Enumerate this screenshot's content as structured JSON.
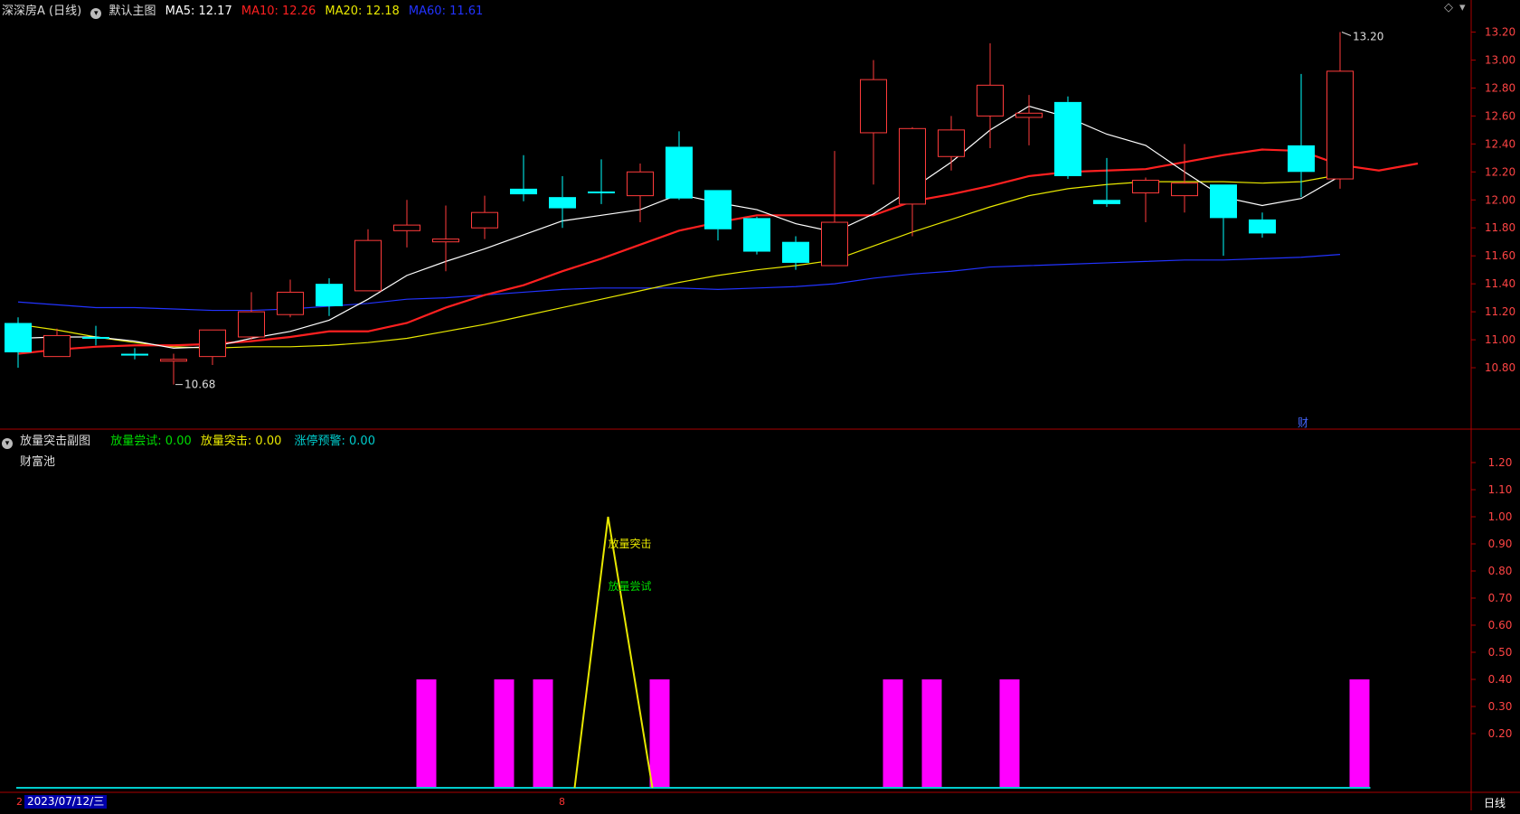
{
  "header": {
    "title": "深深房A (日线)",
    "main_chart_btn": "默认主图",
    "ma5_label": "MA5: 12.17",
    "ma10_label": "MA10: 12.26",
    "ma20_label": "MA20: 12.18",
    "ma60_label": "MA60: 11.61",
    "diamond_icon": "◇",
    "dropdown_icon": "▾"
  },
  "sub_header": {
    "title": "放量突击副图",
    "trial_label": "放量尝试: 0.00",
    "breakout_label": "放量突击: 0.00",
    "limitup_label": "涨停预警: 0.00",
    "pool_label": "财富池"
  },
  "colors": {
    "up": "#ff3b3b",
    "down": "#00ffff",
    "ma5": "#ffffff",
    "ma10": "#ff2020",
    "ma20": "#e8e800",
    "ma60": "#2233ff",
    "axis": "#aa0000",
    "magenta": "#ff00ff",
    "green": "#00dd00",
    "cyan": "#00cccc"
  },
  "bottom_bar": {
    "date": "2023/07/12/三",
    "left_marker": "2",
    "mid_marker": "8",
    "period": "日线"
  },
  "chart_data": [
    {
      "type": "candlestick",
      "ylim": [
        10.6,
        13.3
      ],
      "yticks": [
        "13.20",
        "13.00",
        "12.80",
        "12.60",
        "12.40",
        "12.20",
        "12.00",
        "11.80",
        "11.60",
        "11.40",
        "11.20",
        "11.00",
        "10.80"
      ],
      "high_annotation": "13.20",
      "low_annotation": "10.68",
      "marker_text": "财",
      "candles": [
        {
          "o": 11.12,
          "c": 10.91,
          "h": 11.16,
          "l": 10.8
        },
        {
          "o": 10.88,
          "c": 11.03,
          "h": 11.08,
          "l": 10.88
        },
        {
          "o": 11.02,
          "c": 11.01,
          "h": 11.1,
          "l": 10.96
        },
        {
          "o": 10.9,
          "c": 10.89,
          "h": 10.94,
          "l": 10.86
        },
        {
          "o": 10.85,
          "c": 10.86,
          "h": 10.9,
          "l": 10.68
        },
        {
          "o": 10.88,
          "c": 11.07,
          "h": 11.07,
          "l": 10.82
        },
        {
          "o": 11.02,
          "c": 11.2,
          "h": 11.34,
          "l": 11.0
        },
        {
          "o": 11.18,
          "c": 11.34,
          "h": 11.43,
          "l": 11.16
        },
        {
          "o": 11.4,
          "c": 11.24,
          "h": 11.44,
          "l": 11.17
        },
        {
          "o": 11.35,
          "c": 11.71,
          "h": 11.79,
          "l": 11.35
        },
        {
          "o": 11.78,
          "c": 11.82,
          "h": 12.0,
          "l": 11.66
        },
        {
          "o": 11.7,
          "c": 11.72,
          "h": 11.96,
          "l": 11.49
        },
        {
          "o": 11.8,
          "c": 11.91,
          "h": 12.03,
          "l": 11.72
        },
        {
          "o": 12.08,
          "c": 12.04,
          "h": 12.32,
          "l": 11.99
        },
        {
          "o": 12.02,
          "c": 11.94,
          "h": 12.17,
          "l": 11.8
        },
        {
          "o": 12.06,
          "c": 12.05,
          "h": 12.29,
          "l": 11.97
        },
        {
          "o": 12.03,
          "c": 12.2,
          "h": 12.26,
          "l": 11.84
        },
        {
          "o": 12.38,
          "c": 12.01,
          "h": 12.49,
          "l": 12.0
        },
        {
          "o": 12.07,
          "c": 11.79,
          "h": 12.07,
          "l": 11.71
        },
        {
          "o": 11.87,
          "c": 11.63,
          "h": 11.88,
          "l": 11.61
        },
        {
          "o": 11.7,
          "c": 11.55,
          "h": 11.74,
          "l": 11.5
        },
        {
          "o": 11.53,
          "c": 11.84,
          "h": 12.35,
          "l": 11.53
        },
        {
          "o": 12.48,
          "c": 12.86,
          "h": 13.0,
          "l": 12.11
        },
        {
          "o": 11.97,
          "c": 12.51,
          "h": 12.52,
          "l": 11.74
        },
        {
          "o": 12.31,
          "c": 12.5,
          "h": 12.6,
          "l": 12.21
        },
        {
          "o": 12.6,
          "c": 12.82,
          "h": 13.12,
          "l": 12.37
        },
        {
          "o": 12.59,
          "c": 12.62,
          "h": 12.75,
          "l": 12.39
        },
        {
          "o": 12.7,
          "c": 12.17,
          "h": 12.74,
          "l": 12.15
        },
        {
          "o": 12.0,
          "c": 11.97,
          "h": 12.3,
          "l": 11.95
        },
        {
          "o": 12.05,
          "c": 12.14,
          "h": 12.16,
          "l": 11.84
        },
        {
          "o": 12.03,
          "c": 12.12,
          "h": 12.4,
          "l": 11.91
        },
        {
          "o": 12.11,
          "c": 11.87,
          "h": 12.11,
          "l": 11.6
        },
        {
          "o": 11.86,
          "c": 11.76,
          "h": 11.91,
          "l": 11.73
        },
        {
          "o": 12.39,
          "c": 12.2,
          "h": 12.9,
          "l": 12.02
        },
        {
          "o": 12.15,
          "c": 12.92,
          "h": 13.2,
          "l": 12.08
        }
      ],
      "ma5": [
        11.01,
        11.02,
        11.02,
        10.99,
        10.94,
        10.95,
        11.01,
        11.06,
        11.14,
        11.29,
        11.46,
        11.56,
        11.65,
        11.75,
        11.85,
        11.89,
        11.93,
        12.04,
        11.98,
        11.93,
        11.83,
        11.77,
        11.9,
        12.08,
        12.27,
        12.5,
        12.67,
        12.59,
        12.47,
        12.39,
        12.2,
        12.02,
        11.96,
        12.01,
        12.17
      ],
      "ma10": [
        10.9,
        10.93,
        10.95,
        10.96,
        10.96,
        10.97,
        10.99,
        11.02,
        11.06,
        11.06,
        11.12,
        11.23,
        11.32,
        11.39,
        11.49,
        11.58,
        11.68,
        11.78,
        11.84,
        11.89,
        11.89,
        11.89,
        11.89,
        11.99,
        12.04,
        12.1,
        12.17,
        12.2,
        12.21,
        12.22,
        12.27,
        12.32,
        12.36,
        12.35,
        12.25,
        12.21,
        12.26
      ],
      "ma20": [
        11.11,
        11.07,
        11.02,
        10.98,
        10.95,
        10.94,
        10.95,
        10.95,
        10.96,
        10.98,
        11.01,
        11.06,
        11.11,
        11.17,
        11.23,
        11.29,
        11.35,
        11.41,
        11.46,
        11.5,
        11.53,
        11.57,
        11.67,
        11.77,
        11.86,
        11.95,
        12.03,
        12.08,
        12.11,
        12.13,
        12.13,
        12.13,
        12.12,
        12.13,
        12.18
      ],
      "ma60": [
        11.27,
        11.25,
        11.23,
        11.23,
        11.22,
        11.21,
        11.21,
        11.22,
        11.24,
        11.26,
        11.29,
        11.3,
        11.32,
        11.34,
        11.36,
        11.37,
        11.37,
        11.37,
        11.36,
        11.37,
        11.38,
        11.4,
        11.44,
        11.47,
        11.49,
        11.52,
        11.53,
        11.54,
        11.55,
        11.56,
        11.57,
        11.57,
        11.58,
        11.59,
        11.61
      ]
    },
    {
      "type": "bar",
      "ylim": [
        0,
        1.25
      ],
      "yticks": [
        "1.20",
        "1.10",
        "1.00",
        "0.90",
        "0.80",
        "0.70",
        "0.60",
        "0.50",
        "0.40",
        "0.30",
        "0.20"
      ],
      "magenta_bars": [
        {
          "index": 10,
          "value": 0.4
        },
        {
          "index": 12,
          "value": 0.4
        },
        {
          "index": 13,
          "value": 0.4
        },
        {
          "index": 16,
          "value": 0.4
        },
        {
          "index": 22,
          "value": 0.4
        },
        {
          "index": 23,
          "value": 0.4
        },
        {
          "index": 25,
          "value": 0.4
        },
        {
          "index": 34,
          "value": 0.4
        }
      ],
      "breakout_spike": {
        "start": 14,
        "peak": 15,
        "end": 16,
        "value": 1.0
      },
      "annotations": {
        "breakout": "放量突击",
        "trial": "放量尝试"
      }
    }
  ]
}
